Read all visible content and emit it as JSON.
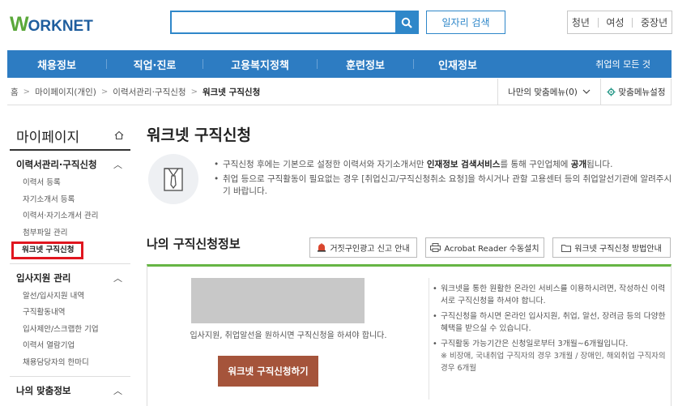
{
  "header": {
    "logo_w": "W",
    "logo_rest": "ORKNET",
    "search_placeholder": "",
    "job_search_label": "일자리 검색",
    "user_types": [
      "청년",
      "여성",
      "중장년"
    ]
  },
  "nav": {
    "items": [
      "채용정보",
      "직업·진로",
      "고용복지정책",
      "훈련정보",
      "인재정보"
    ],
    "all_label": "취업의 모든 것"
  },
  "breadcrumb": {
    "items": [
      "홈",
      "마이페이지(개인)",
      "이력서관리·구직신청",
      "워크넷 구직신청"
    ],
    "custom_menu_label": "나만의 맞춤메뉴(0)",
    "custom_set_label": "맞춤메뉴설정"
  },
  "sidebar": {
    "title": "마이페이지",
    "sections": [
      {
        "title": "이력서관리·구직신청",
        "items": [
          "이력서 등록",
          "자기소개서 등록",
          "이력서·자기소개서 관리",
          "첨부파일 관리",
          "워크넷 구직신청"
        ]
      },
      {
        "title": "입사지원 관리",
        "items": [
          "알선/입사지원 내역",
          "구직활동내역",
          "입사제안/스크랩한 기업",
          "이력서 열람기업",
          "채용담당자의 한마디"
        ]
      },
      {
        "title": "나의 맞춤정보",
        "items": []
      }
    ]
  },
  "main": {
    "title": "워크넷 구직신청",
    "notes": [
      {
        "pre": "구직신청 후에는 기본으로 설정한 이력서와 자기소개서만 ",
        "b1": "인재정보 검색서비스",
        "mid": "를 통해 구인업체에 ",
        "b2": "공개",
        "post": "됩니다."
      },
      {
        "text": "취업 등으로 구직활동이 필요없는 경우 [취업신고/구직신청취소 요청]을 하시거나 관할 고용센터 등의 취업알선기관에 알려주시기 바랍니다."
      }
    ],
    "section_title": "나의 구직신청정보",
    "buttons": [
      "거짓구인광고 신고 안내",
      "Acrobat Reader 수동설치",
      "워크넷 구직신청 방법안내"
    ],
    "panel_message": "입사지원, 취업알선을 원하시면 구직신청을 하셔야 합니다.",
    "apply_label": "워크넷 구직신청하기",
    "panel_notes": [
      "워크넷을 통한 원활한 온라인 서비스를 이용하시려면, 작성하신 이력서로 구직신청을 하셔야 합니다.",
      "구직신청을 하시면 온라인 입사지원, 취업, 알선, 장려금 등의 다양한 혜택을 받으실 수 있습니다.",
      "구직활동 가능기간은 신청일로부터 3개월~6개월입니다."
    ],
    "panel_subnote": "※ 비장애, 국내취업 구직자의 경우 3개월 / 장애인, 해외취업 구직자의 경우 6개월"
  }
}
